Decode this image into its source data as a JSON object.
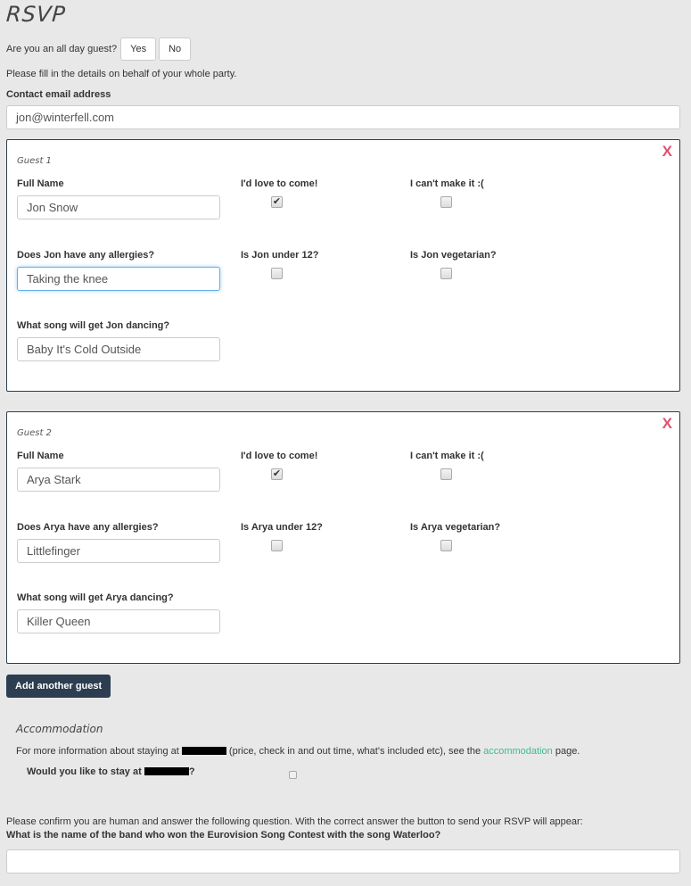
{
  "page": {
    "title": "RSVP",
    "all_day_question": "Are you an all day guest?",
    "all_day_yes": "Yes",
    "all_day_no": "No",
    "intro": "Please fill in the details on behalf of your whole party.",
    "email_label": "Contact email address",
    "email_value": "jon@winterfell.com"
  },
  "guests": [
    {
      "title": "Guest 1",
      "close_icon": "X",
      "full_name_label": "Full Name",
      "full_name": "Jon Snow",
      "love_to_come_label": "I'd love to come!",
      "love_to_come": true,
      "cant_make_it_label": "I can't make it :(",
      "cant_make_it": false,
      "allergies_label": "Does Jon have any allergies?",
      "allergies": "Taking the knee",
      "under12_label": "Is Jon under 12?",
      "under12": false,
      "vegetarian_label": "Is Jon vegetarian?",
      "vegetarian": false,
      "song_label": "What song will get Jon dancing?",
      "song": "Baby It's Cold Outside"
    },
    {
      "title": "Guest 2",
      "close_icon": "X",
      "full_name_label": "Full Name",
      "full_name": "Arya Stark",
      "love_to_come_label": "I'd love to come!",
      "love_to_come": true,
      "cant_make_it_label": "I can't make it :(",
      "cant_make_it": false,
      "allergies_label": "Does Arya have any allergies?",
      "allergies": "Littlefinger",
      "under12_label": "Is Arya under 12?",
      "under12": false,
      "vegetarian_label": "Is Arya vegetarian?",
      "vegetarian": false,
      "song_label": "What song will get Arya dancing?",
      "song": "Killer Queen"
    }
  ],
  "add_guest_label": "Add another guest",
  "accommodation": {
    "title": "Accommodation",
    "info_before": "For more information about staying at ",
    "info_middle": " (price, check in and out time, what's included etc), see the ",
    "link_text": "accommodation",
    "info_after": " page.",
    "question_before": "Would you like to stay at ",
    "question_after": "?",
    "stay": false,
    "link_color": "#3bbd8f"
  },
  "human_check": {
    "instruction": "Please confirm you are human and answer the following question. With the correct answer the button to send your RSVP will appear:",
    "question": "What is the name of the band who won the Eurovision Song Contest with the song Waterloo?",
    "answer": ""
  },
  "colors": {
    "card_border": "#2c3e50",
    "close_icon": "#e05271",
    "primary_button": "#2c3e50"
  }
}
